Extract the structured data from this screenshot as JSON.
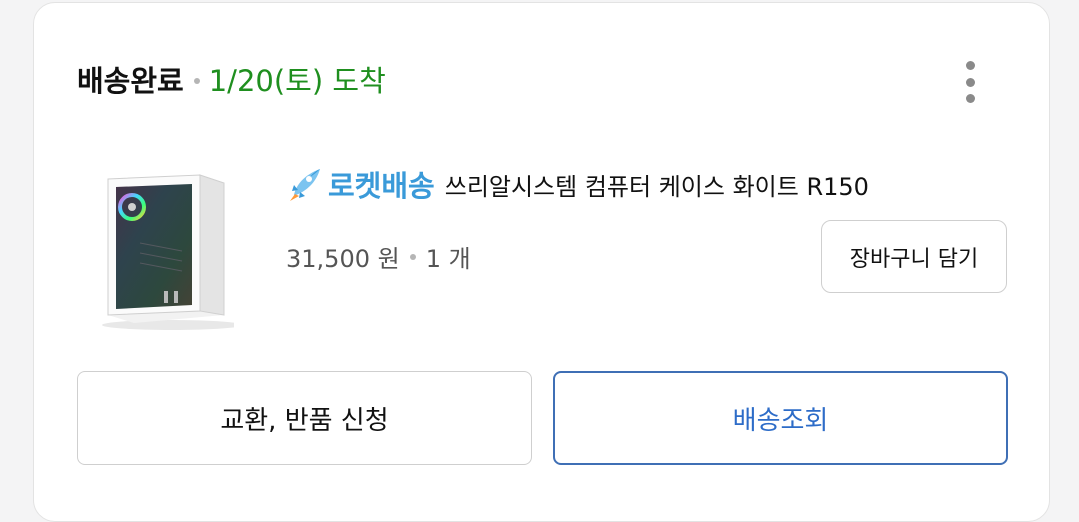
{
  "order": {
    "status_label": "배송완료",
    "status_date": "1/20(토) 도착",
    "more_icon": "more-vertical-icon"
  },
  "product": {
    "badge": "로켓배송",
    "badge_icon": "rocket-icon",
    "name": "쓰리알시스템 컴퓨터 케이스 화이트 R150",
    "price": "31,500 원",
    "quantity": "1 개",
    "thumbnail": "pc-case-image"
  },
  "actions": {
    "add_to_cart": "장바구니 담기",
    "return_exchange": "교환, 반품 신청",
    "track_delivery": "배송조회"
  },
  "colors": {
    "status_green": "#1f8f1f",
    "rocket_blue": "#3a9ad9",
    "primary_blue": "#2d6cc8"
  }
}
